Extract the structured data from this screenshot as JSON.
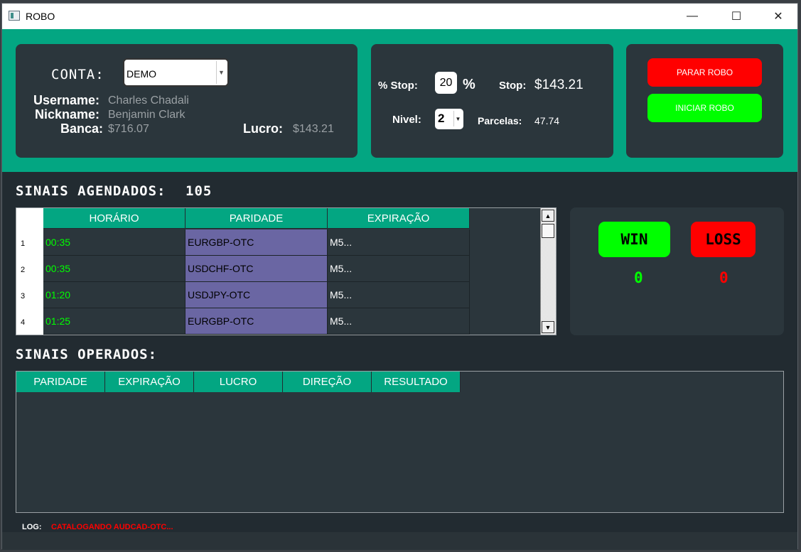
{
  "window": {
    "title": "ROBO",
    "minimize_glyph": "—",
    "maximize_glyph": "☐",
    "close_glyph": "✕"
  },
  "account": {
    "conta_label": "CONTA:",
    "conta_value": "DEMO",
    "username_label": "Username:",
    "username_value": "Charles Chadali",
    "nickname_label": "Nickname:",
    "nickname_value": "Benjamin Clark",
    "banca_label": "Banca:",
    "banca_value": "$716.07",
    "lucro_label": "Lucro:",
    "lucro_value": "$143.21"
  },
  "stop": {
    "pct_stop_label": "% Stop:",
    "pct_stop_value": "20",
    "pct_symbol": "%",
    "stop_label": "Stop:",
    "stop_value": "$143.21",
    "nivel_label": "Nivel:",
    "nivel_value": "2",
    "parcelas_label": "Parcelas:",
    "parcelas_value": "47.74"
  },
  "actions": {
    "stop_button": "PARAR ROBO",
    "start_button": "INICIAR ROBO"
  },
  "scheduled": {
    "title": "SINAIS AGENDADOS:",
    "count": "105",
    "headers": [
      "HORÁRIO",
      "PARIDADE",
      "EXPIRAÇÃO"
    ],
    "rows": [
      {
        "num": "1",
        "time": "00:35",
        "pair": "EURGBP-OTC",
        "exp": "M5..."
      },
      {
        "num": "2",
        "time": "00:35",
        "pair": "USDCHF-OTC",
        "exp": "M5..."
      },
      {
        "num": "3",
        "time": "01:20",
        "pair": "USDJPY-OTC",
        "exp": "M5..."
      },
      {
        "num": "4",
        "time": "01:25",
        "pair": "EURGBP-OTC",
        "exp": "M5..."
      }
    ]
  },
  "score": {
    "win_label": "WIN",
    "loss_label": "LOSS",
    "win_count": "0",
    "loss_count": "0"
  },
  "operated": {
    "title": "SINAIS OPERADOS:",
    "headers": [
      "PARIDADE",
      "EXPIRAÇÃO",
      "LUCRO",
      "DIREÇÃO",
      "RESULTADO"
    ]
  },
  "log": {
    "label": "LOG:",
    "value": "CATALOGANDO AUDCAD-OTC..."
  },
  "colors": {
    "accent": "#03a682",
    "panel": "#2b363c",
    "background": "#222b31",
    "win": "#00ff00",
    "loss": "#ff0000",
    "pair_cell": "#6a66a3"
  }
}
